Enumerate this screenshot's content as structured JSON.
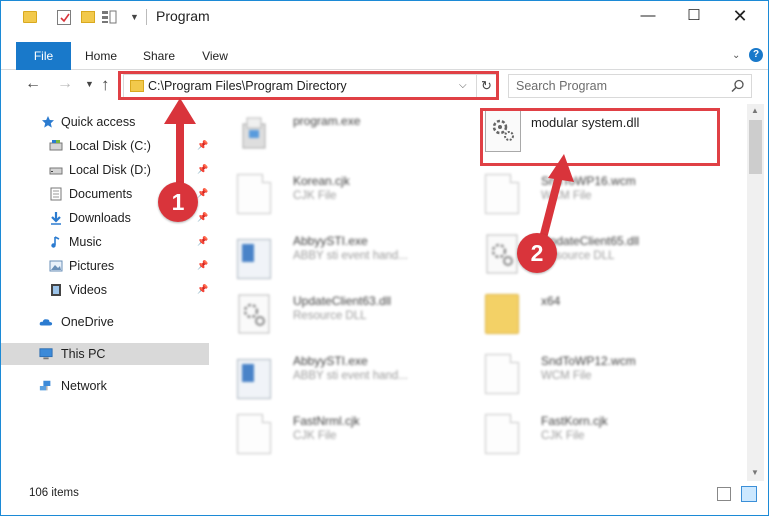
{
  "window": {
    "title": "Program",
    "controls": {
      "minimize": "—",
      "maximize": "☐",
      "close": "✕"
    }
  },
  "ribbon": {
    "tabs": [
      "File",
      "Home",
      "Share",
      "View"
    ]
  },
  "address_bar": {
    "path": "C:\\Program Files\\Program Directory",
    "refresh_glyph": "↻"
  },
  "search": {
    "placeholder": "Search Program"
  },
  "sidebar": {
    "items": [
      {
        "label": "Quick access",
        "icon": "star-icon",
        "pinned": false
      },
      {
        "label": "Local Disk (C:)",
        "icon": "drive-icon",
        "pinned": true
      },
      {
        "label": "Local Disk (D:)",
        "icon": "drive-icon",
        "pinned": true
      },
      {
        "label": "Documents",
        "icon": "documents-icon",
        "pinned": true
      },
      {
        "label": "Downloads",
        "icon": "download-icon",
        "pinned": true
      },
      {
        "label": "Music",
        "icon": "music-icon",
        "pinned": true
      },
      {
        "label": "Pictures",
        "icon": "pictures-icon",
        "pinned": true
      },
      {
        "label": "Videos",
        "icon": "videos-icon",
        "pinned": true
      },
      {
        "label": "OneDrive",
        "icon": "cloud-icon",
        "pinned": false
      },
      {
        "label": "This PC",
        "icon": "computer-icon",
        "pinned": false
      },
      {
        "label": "Network",
        "icon": "network-icon",
        "pinned": false
      }
    ]
  },
  "files": [
    {
      "name": "program.exe",
      "type": "",
      "icon": "installer-icon"
    },
    {
      "name": "modular system.dll",
      "type": "",
      "icon": "dll-gear-icon"
    },
    {
      "name": "Korean.cjk",
      "type": "CJK File",
      "icon": "document-icon"
    },
    {
      "name": "SndToWP16.wcm",
      "type": "WCM File",
      "icon": "document-icon"
    },
    {
      "name": "AbbyySTI.exe",
      "type": "ABBY sti event hand...",
      "icon": "exe-icon"
    },
    {
      "name": "UpdateClient65.dll",
      "type": "Resource DLL",
      "icon": "dll-gear-icon"
    },
    {
      "name": "UpdateClient63.dll",
      "type": "Resource DLL",
      "icon": "dll-gear-icon"
    },
    {
      "name": "x64",
      "type": "",
      "icon": "folder-icon"
    },
    {
      "name": "AbbyySTI.exe",
      "type": "ABBY sti event hand...",
      "icon": "exe-icon"
    },
    {
      "name": "SndToWP12.wcm",
      "type": "WCM File",
      "icon": "document-icon"
    },
    {
      "name": "FastNrml.cjk",
      "type": "CJK File",
      "icon": "document-icon"
    },
    {
      "name": "FastKorn.cjk",
      "type": "CJK File",
      "icon": "document-icon"
    }
  ],
  "status": {
    "item_count": "106 items"
  },
  "annotations": {
    "markers": [
      "1",
      "2"
    ],
    "color": "#d9343b"
  },
  "colors": {
    "accent": "#1979ca",
    "highlight": "#e04045",
    "folder": "#f2c94c"
  }
}
